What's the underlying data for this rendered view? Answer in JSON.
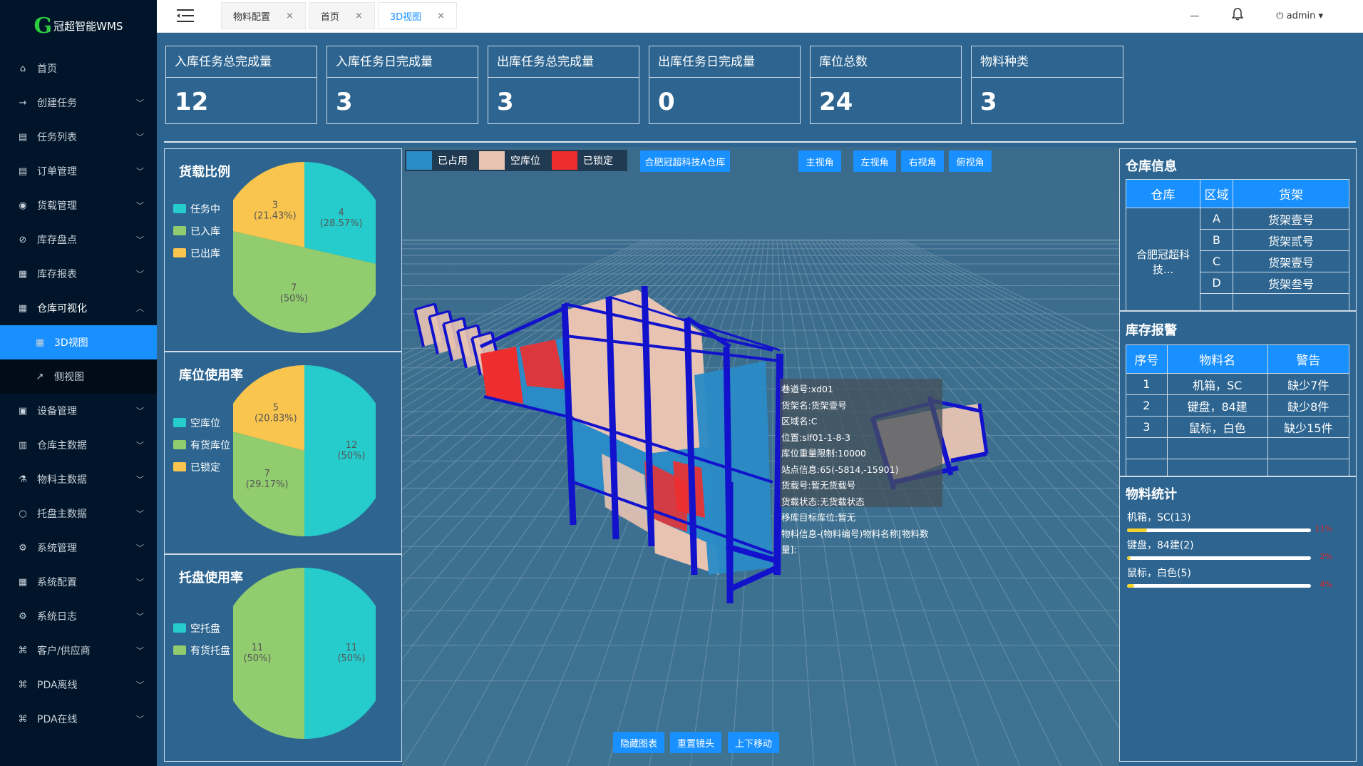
{
  "app": {
    "logo_g": "G",
    "name": "冠超智能WMS"
  },
  "sidebar": {
    "items": [
      {
        "label": "首页",
        "icon": "home-icon",
        "glyph": "⌂",
        "chev": ""
      },
      {
        "label": "创建任务",
        "icon": "arrow-right-icon",
        "glyph": "→",
        "chev": "﹀"
      },
      {
        "label": "任务列表",
        "icon": "list-icon",
        "glyph": "▤",
        "chev": "﹀"
      },
      {
        "label": "订单管理",
        "icon": "order-icon",
        "glyph": "▤",
        "chev": "﹀"
      },
      {
        "label": "货载管理",
        "icon": "database-icon",
        "glyph": "◉",
        "chev": "﹀"
      },
      {
        "label": "库存盘点",
        "icon": "inventory-icon",
        "glyph": "⊘",
        "chev": "﹀"
      },
      {
        "label": "库存报表",
        "icon": "report-icon",
        "glyph": "▦",
        "chev": "﹀"
      },
      {
        "label": "仓库可视化",
        "icon": "grid-icon",
        "glyph": "▦",
        "chev": "︿"
      }
    ],
    "sub_items": [
      {
        "label": "3D视图",
        "icon": "grid-small-icon",
        "glyph": "▦"
      },
      {
        "label": "侧视图",
        "icon": "external-link-icon",
        "glyph": "↗"
      }
    ],
    "items_after": [
      {
        "label": "设备管理",
        "icon": "device-icon",
        "glyph": "▣",
        "chev": "﹀"
      },
      {
        "label": "仓库主数据",
        "icon": "bar-chart-icon",
        "glyph": "▥",
        "chev": "﹀"
      },
      {
        "label": "物料主数据",
        "icon": "flask-icon",
        "glyph": "⚗",
        "chev": "﹀"
      },
      {
        "label": "托盘主数据",
        "icon": "circle-icon",
        "glyph": "○",
        "chev": "﹀"
      },
      {
        "label": "系统管理",
        "icon": "settings-icon",
        "glyph": "⚙",
        "chev": "﹀"
      },
      {
        "label": "系统配置",
        "icon": "apps-icon",
        "glyph": "▦",
        "chev": "﹀"
      },
      {
        "label": "系统日志",
        "icon": "log-icon",
        "glyph": "⚙",
        "chev": "﹀"
      },
      {
        "label": "客户/供应商",
        "icon": "customer-icon",
        "glyph": "⌘",
        "chev": "﹀"
      },
      {
        "label": "PDA离线",
        "icon": "pda-offline-icon",
        "glyph": "⌘",
        "chev": "﹀"
      },
      {
        "label": "PDA在线",
        "icon": "pda-online-icon",
        "glyph": "⌘",
        "chev": "﹀"
      }
    ]
  },
  "header": {
    "tabs": [
      {
        "label": "物料配置",
        "close": "×"
      },
      {
        "label": "首页",
        "close": "×"
      },
      {
        "label": "3D视图",
        "close": "×"
      }
    ],
    "minimize": "—",
    "bell": "🔔",
    "user": "⏻ admin ▾"
  },
  "stats": [
    {
      "label": "入库任务总完成量",
      "value": "12"
    },
    {
      "label": "入库任务日完成量",
      "value": "3"
    },
    {
      "label": "出库任务总完成量",
      "value": "3"
    },
    {
      "label": "出库任务日完成量",
      "value": "0"
    },
    {
      "label": "库位总数",
      "value": "24"
    },
    {
      "label": "物料种类",
      "value": "3"
    }
  ],
  "colors": {
    "teal": "#26cccc",
    "green": "#91cc6e",
    "yellow": "#f9c54e",
    "blue": "#1890ff",
    "occupied": "#2a8bc7",
    "empty": "#e8c3b1",
    "locked": "#ee2e2e"
  },
  "chart_data": [
    {
      "type": "pie",
      "title": "货载比例",
      "slices": [
        {
          "name": "任务中",
          "value": 4,
          "pct": "28.57%"
        },
        {
          "name": "已入库",
          "value": 7,
          "pct": "50%"
        },
        {
          "name": "已出库",
          "value": 3,
          "pct": "21.43%"
        }
      ]
    },
    {
      "type": "pie",
      "title": "库位使用率",
      "slices": [
        {
          "name": "空库位",
          "value": 12,
          "pct": "50%"
        },
        {
          "name": "有货库位",
          "value": 7,
          "pct": "29.17%"
        },
        {
          "name": "已锁定",
          "value": 5,
          "pct": "20.83%"
        }
      ]
    },
    {
      "type": "pie",
      "title": "托盘使用率",
      "slices": [
        {
          "name": "空托盘",
          "value": 11,
          "pct": "50%"
        },
        {
          "name": "有货托盘",
          "value": 11,
          "pct": "50%"
        }
      ]
    }
  ],
  "view": {
    "legend": {
      "occupied": "已占用",
      "empty": "空库位",
      "locked": "已锁定"
    },
    "warehouse_button": "合肥冠超科技A仓库",
    "camera_buttons": [
      "主视角",
      "左视角",
      "右视角",
      "俯视角"
    ],
    "bottom_buttons": [
      "隐藏图表",
      "重置镜头",
      "上下移动"
    ],
    "tooltip": [
      "巷道号:xd01",
      "货架名:货架壹号",
      "区域名:C",
      "位置:slf01-1-8-3",
      "库位重量限制:10000",
      "站点信息:65(-5814,-15901)",
      "货载号:暂无货载号",
      "货载状态:无货载状态",
      "移库目标库位:暂无",
      "物料信息-(物料编号)物料名称[物料数量]:"
    ]
  },
  "warehouse_info": {
    "title": "仓库信息",
    "headers": [
      "仓库",
      "区域",
      "货架"
    ],
    "warehouse": "合肥冠超科技...",
    "rows": [
      [
        "A",
        "货架壹号"
      ],
      [
        "B",
        "货架贰号"
      ],
      [
        "C",
        "货架壹号"
      ],
      [
        "D",
        "货架叁号"
      ]
    ]
  },
  "stock_alert": {
    "title": "库存报警",
    "headers": [
      "序号",
      "物料名",
      "警告"
    ],
    "rows": [
      [
        "1",
        "机箱，SC",
        "缺少7件"
      ],
      [
        "2",
        "键盘，84建",
        "缺少8件"
      ],
      [
        "3",
        "鼠标，白色",
        "缺少15件"
      ]
    ]
  },
  "material_stats": {
    "title": "物料统计",
    "items": [
      {
        "label": "机箱，SC(13)",
        "pct": 0.11,
        "pct_text": "11%"
      },
      {
        "label": "键盘，84建(2)",
        "pct": 0.02,
        "pct_text": "2%"
      },
      {
        "label": "鼠标，白色(5)",
        "pct": 0.04,
        "pct_text": "4%"
      }
    ]
  }
}
